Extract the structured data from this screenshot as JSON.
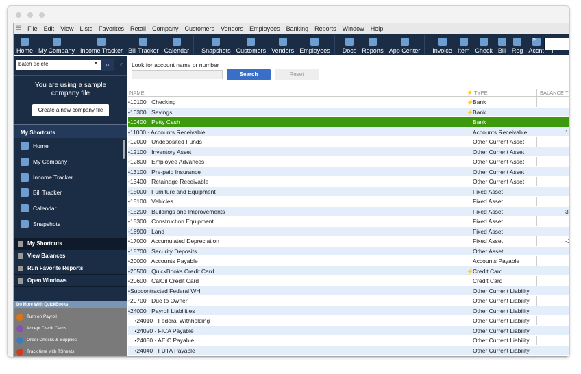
{
  "menu": [
    "File",
    "Edit",
    "View",
    "Lists",
    "Favorites",
    "Retail",
    "Company",
    "Customers",
    "Vendors",
    "Employees",
    "Banking",
    "Reports",
    "Window",
    "Help"
  ],
  "toolbar": [
    "Home",
    "My Company",
    "Income Tracker",
    "Bill Tracker",
    "Calendar",
    "|",
    "Snapshots",
    "Customers",
    "Vendors",
    "Employees",
    "|",
    "Docs",
    "Reports",
    "App Center",
    "|",
    "Invoice",
    "Item",
    "Check",
    "Bill",
    "Reg",
    "Accnt",
    "F"
  ],
  "toolbar_more": "»",
  "left": {
    "search_value": "batch delete",
    "sample_text": "You are using a sample company file",
    "create_button": "Create a new company file",
    "shortcuts_header": "My Shortcuts",
    "shortcuts": [
      "Home",
      "My Company",
      "Income Tracker",
      "Bill Tracker",
      "Calendar",
      "Snapshots"
    ],
    "nav": [
      "My Shortcuts",
      "View Balances",
      "Run Favorite Reports",
      "Open Windows"
    ],
    "more_header": "Do More With QuickBooks",
    "more": [
      {
        "label": "Turn on Payroll",
        "color": "#d9731c"
      },
      {
        "label": "Accept Credit Cards",
        "color": "#8a4fb0"
      },
      {
        "label": "Order Checks & Supplies",
        "color": "#3a7cc4"
      },
      {
        "label": "Track time with TSheets",
        "color": "#d23a1a"
      }
    ]
  },
  "main": {
    "search_label": "Look for account name or number",
    "search_value": "",
    "search_button": "Search",
    "reset_button": "Reset",
    "columns": {
      "name": "NAME",
      "online": "⚡",
      "type": "TYPE",
      "balance": "BALANCE T"
    },
    "rows": [
      {
        "name": "•10100 · Checking",
        "online": "⚡",
        "type": "Bank",
        "bal": ""
      },
      {
        "name": "•10300 · Savings",
        "online": "⚡",
        "type": "Bank",
        "bal": ""
      },
      {
        "name": "•10400 · Petty Cash",
        "online": "",
        "type": "Bank",
        "bal": "",
        "selected": true
      },
      {
        "name": "•11000 · Accounts Receivable",
        "online": "",
        "type": "Accounts Receivable",
        "bal": "1"
      },
      {
        "name": "•12000 · Undeposited Funds",
        "online": "",
        "type": "Other Current Asset",
        "bal": ""
      },
      {
        "name": "•12100 · Inventory Asset",
        "online": "",
        "type": "Other Current Asset",
        "bal": ""
      },
      {
        "name": "•12800 · Employee Advances",
        "online": "",
        "type": "Other Current Asset",
        "bal": ""
      },
      {
        "name": "•13100 · Pre-paid Insurance",
        "online": "",
        "type": "Other Current Asset",
        "bal": ""
      },
      {
        "name": "•13400 · Retainage Receivable",
        "online": "",
        "type": "Other Current Asset",
        "bal": ""
      },
      {
        "name": "•15000 · Furniture and Equipment",
        "online": "",
        "type": "Fixed Asset",
        "bal": ""
      },
      {
        "name": "•15100 · Vehicles",
        "online": "",
        "type": "Fixed Asset",
        "bal": ""
      },
      {
        "name": "•15200 · Buildings and Improvements",
        "online": "",
        "type": "Fixed Asset",
        "bal": "3"
      },
      {
        "name": "•15300 · Construction Equipment",
        "online": "",
        "type": "Fixed Asset",
        "bal": ""
      },
      {
        "name": "•16900 · Land",
        "online": "",
        "type": "Fixed Asset",
        "bal": ""
      },
      {
        "name": "•17000 · Accumulated Depreciation",
        "online": "",
        "type": "Fixed Asset",
        "bal": "-1"
      },
      {
        "name": "•18700 · Security Deposits",
        "online": "",
        "type": "Other Asset",
        "bal": ""
      },
      {
        "name": "•20000 · Accounts Payable",
        "online": "",
        "type": "Accounts Payable",
        "bal": ""
      },
      {
        "name": "•20500 · QuickBooks Credit Card",
        "online": "⚡",
        "type": "Credit Card",
        "bal": ""
      },
      {
        "name": "•20600 · CalOil Credit Card",
        "online": "",
        "type": "Credit Card",
        "bal": ""
      },
      {
        "name": "•Subcontracted Federal WH",
        "online": "",
        "type": "Other Current Liability",
        "bal": ""
      },
      {
        "name": "•20700 · Due to Owner",
        "online": "",
        "type": "Other Current Liability",
        "bal": ""
      },
      {
        "name": "•24000 · Payroll Liabilities",
        "online": "",
        "type": "Other Current Liability",
        "bal": ""
      },
      {
        "name": "    •24010 · Federal Withholding",
        "online": "",
        "type": "Other Current Liability",
        "bal": ""
      },
      {
        "name": "    •24020 · FICA Payable",
        "online": "",
        "type": "Other Current Liability",
        "bal": ""
      },
      {
        "name": "    •24030 · AEIC Payable",
        "online": "",
        "type": "Other Current Liability",
        "bal": ""
      },
      {
        "name": "    •24040 · FUTA Payable",
        "online": "",
        "type": "Other Current Liability",
        "bal": ""
      }
    ]
  }
}
